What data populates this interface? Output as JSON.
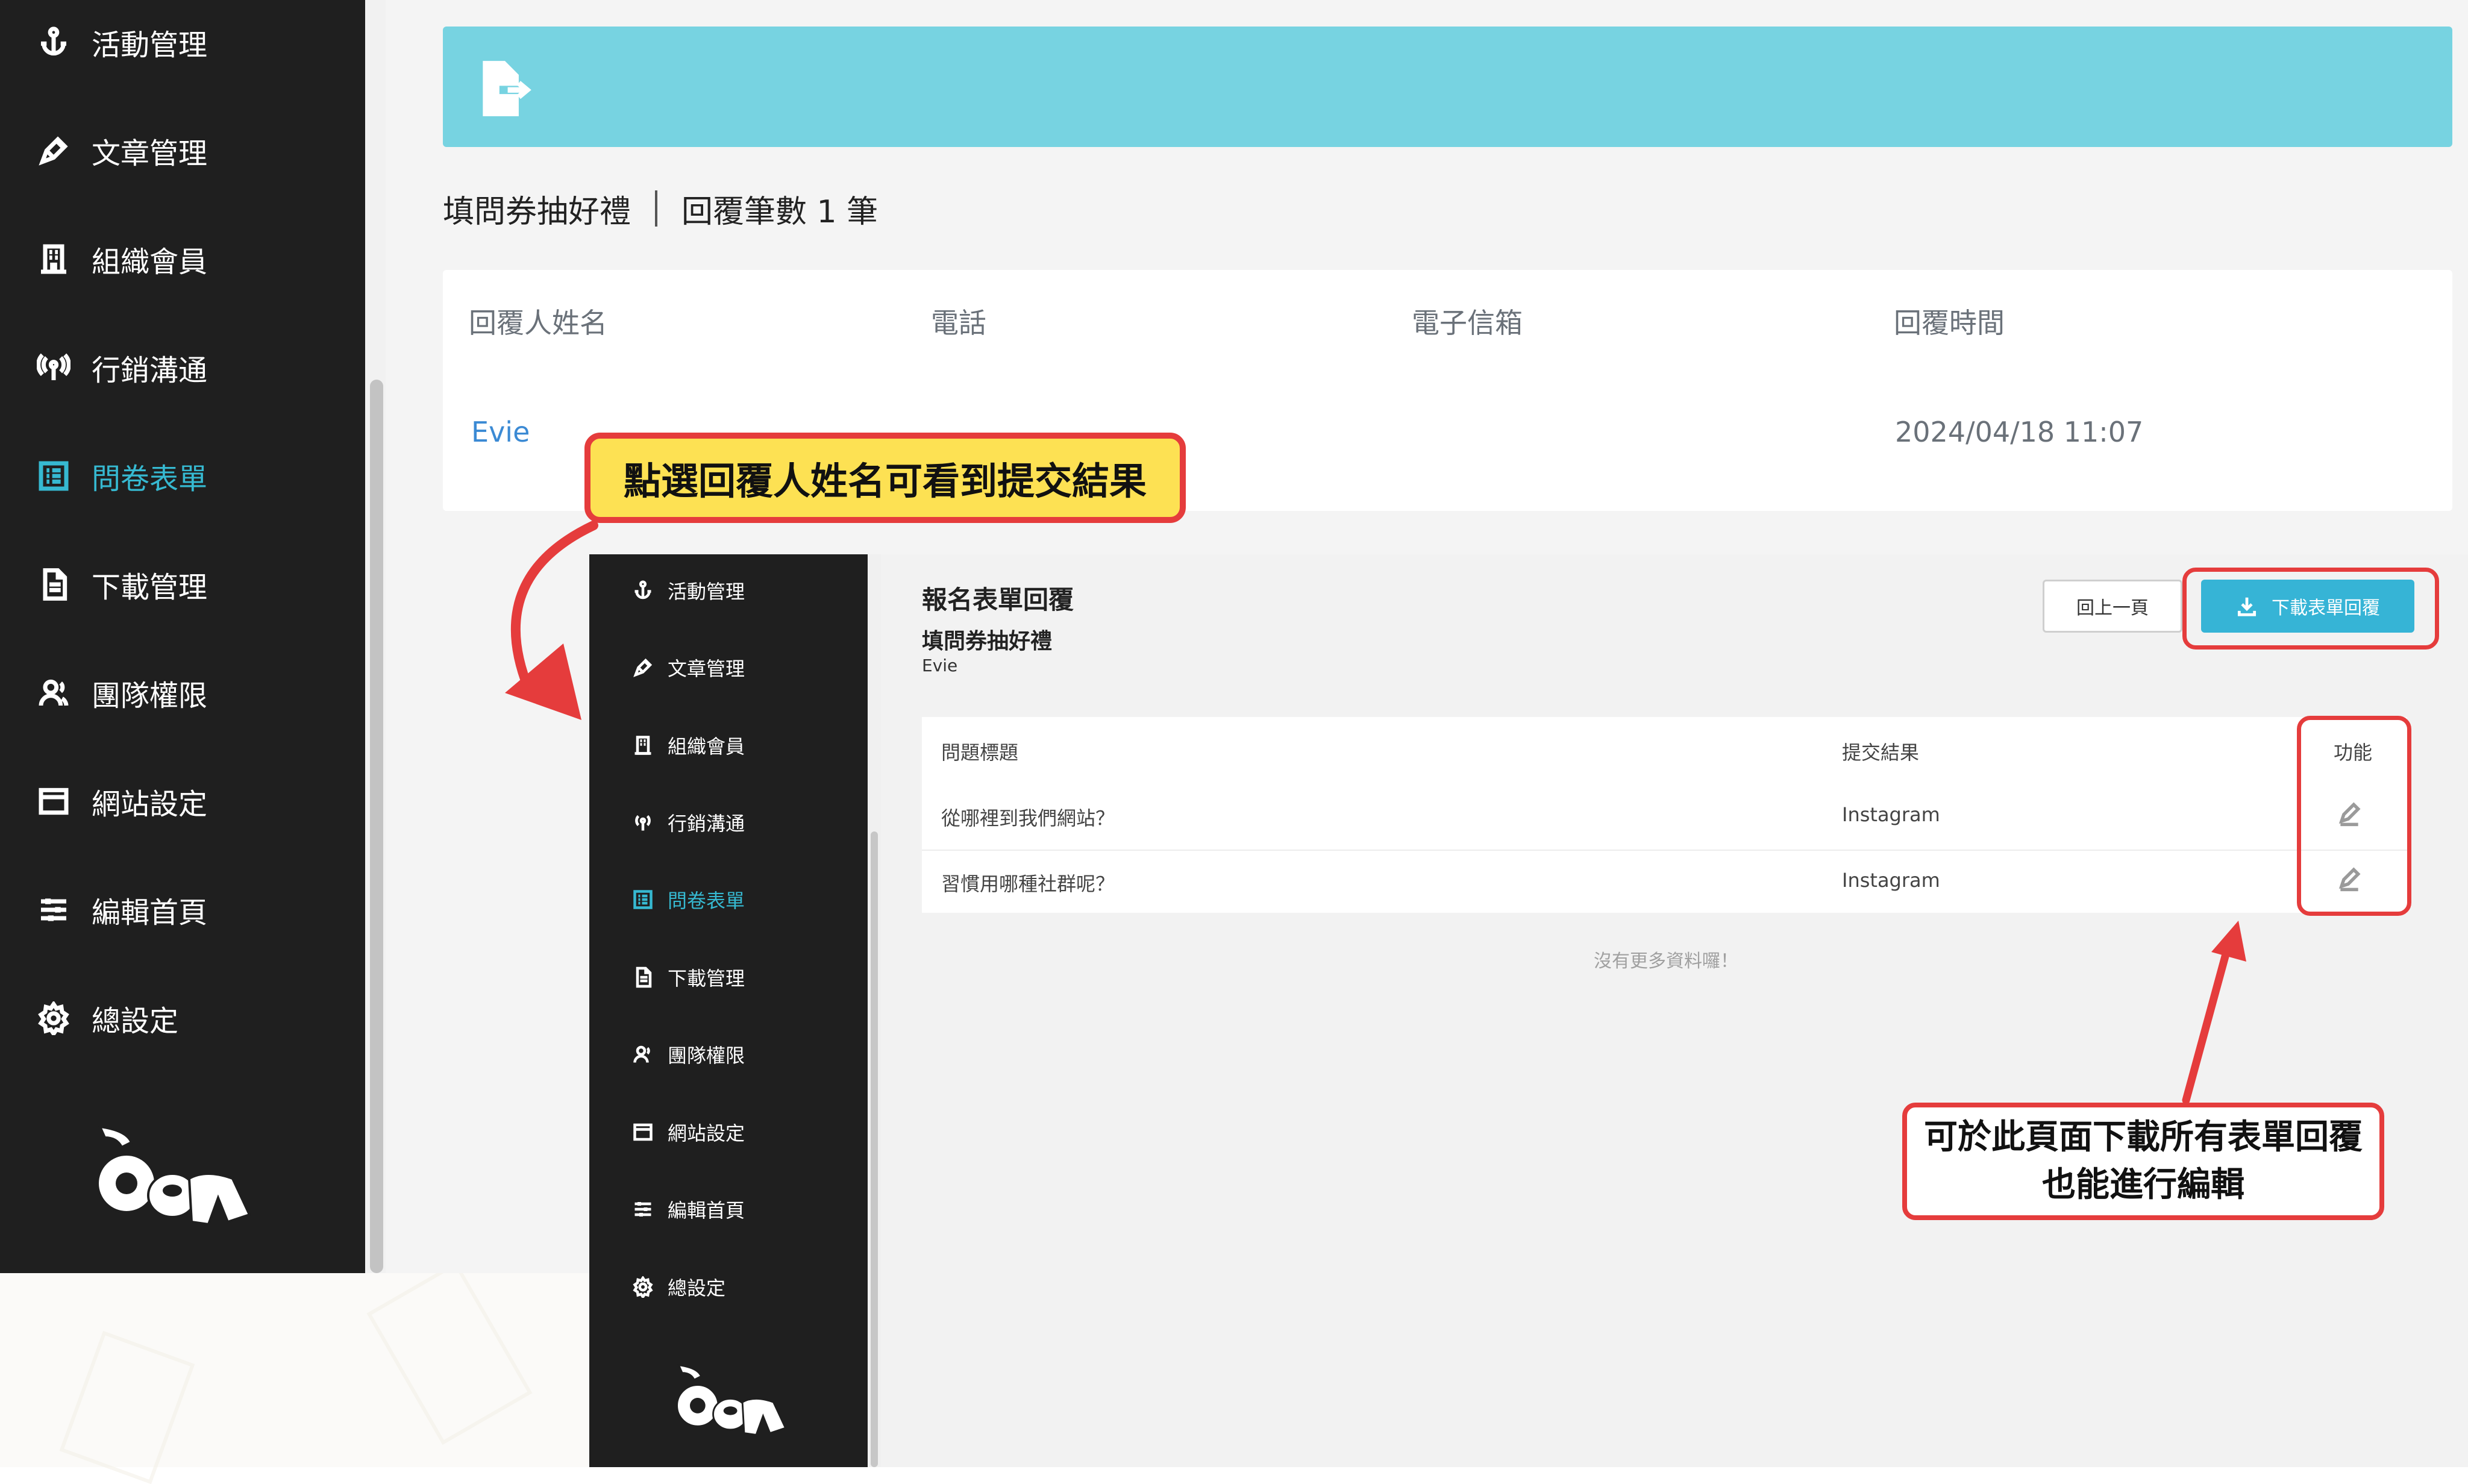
{
  "sidebar": {
    "items": [
      {
        "label": "活動管理",
        "icon": "anchor-icon"
      },
      {
        "label": "文章管理",
        "icon": "pen-icon"
      },
      {
        "label": "組織會員",
        "icon": "building-icon"
      },
      {
        "label": "行銷溝通",
        "icon": "broadcast-icon"
      },
      {
        "label": "問卷表單",
        "icon": "list-icon",
        "active": true
      },
      {
        "label": "下載管理",
        "icon": "file-icon"
      },
      {
        "label": "團隊權限",
        "icon": "users-icon"
      },
      {
        "label": "網站設定",
        "icon": "window-icon"
      },
      {
        "label": "編輯首頁",
        "icon": "sliders-icon"
      },
      {
        "label": "總設定",
        "icon": "gear-icon"
      }
    ],
    "active_color": "#36b9d1"
  },
  "main": {
    "survey_name": "填問券抽好禮",
    "reply_count": "回覆筆數 1 筆",
    "table": {
      "headers": [
        "回覆人姓名",
        "電話",
        "電子信箱",
        "回覆時間"
      ],
      "rows": [
        {
          "name": "Evie",
          "time": "2024/04/18 11:07"
        }
      ]
    }
  },
  "detail": {
    "title": "報名表單回覆",
    "survey_name": "填問券抽好禮",
    "respondent": "Evie",
    "back_label": "回上一頁",
    "download_label": "下載表單回覆",
    "table": {
      "headers": [
        "問題標題",
        "提交結果",
        "功能"
      ],
      "rows": [
        {
          "question": "從哪裡到我們網站？",
          "answer": "Instagram"
        },
        {
          "question": "習慣用哪種社群呢？",
          "answer": "Instagram"
        }
      ]
    },
    "no_more": "沒有更多資料囉！"
  },
  "annotations": {
    "top": "點選回覆人姓名可看到提交結果",
    "bottom_line1": "可於此頁面下載所有表單回覆",
    "bottom_line2": "也能進行編輯",
    "color": "#e53c3c",
    "highlight": "#fde153"
  }
}
